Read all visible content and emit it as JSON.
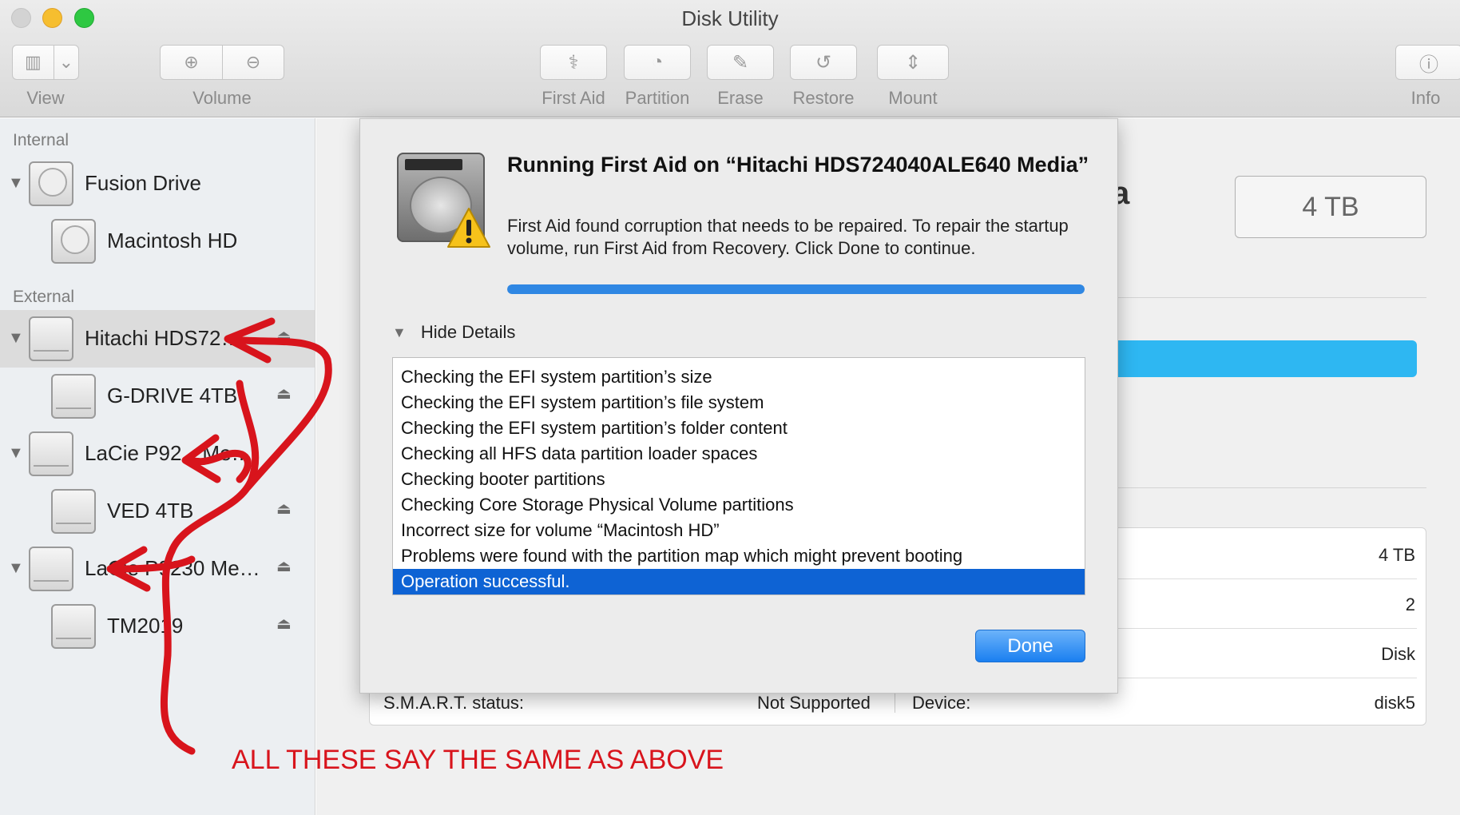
{
  "window": {
    "title": "Disk Utility"
  },
  "toolbar": {
    "view_label": "View",
    "volume_label": "Volume",
    "first_aid_label": "First Aid",
    "partition_label": "Partition",
    "erase_label": "Erase",
    "restore_label": "Restore",
    "mount_label": "Mount",
    "info_label": "Info"
  },
  "sidebar": {
    "internal_header": "Internal",
    "external_header": "External",
    "fusion_drive": "Fusion Drive",
    "macintosh_hd": "Macintosh HD",
    "hitachi": "Hitachi HDS72…",
    "g_drive": "G-DRIVE 4TB",
    "lacie_1": "LaCie P92…Me…",
    "ved": "VED 4TB",
    "lacie_2": "LaCie P9230 Me…",
    "tm2019": "TM2019"
  },
  "main": {
    "title_fragment": "a",
    "capacity": "4 TB",
    "rows": [
      {
        "value": "4 TB"
      },
      {
        "value": "2"
      },
      {
        "value": "Disk"
      }
    ],
    "smart_label": "S.M.A.R.T. status:",
    "smart_value": "Not Supported",
    "device_label": "Device:",
    "device_value": "disk5"
  },
  "sheet": {
    "title": "Running First Aid on “Hitachi HDS724040ALE640 Media”",
    "message": "First Aid found corruption that needs to be repaired. To repair the startup volume, run First Aid from Recovery. Click Done to continue.",
    "progress": 1.0,
    "details_toggle": "Hide Details",
    "log": [
      "Checking the EFI system partition’s size",
      "Checking the EFI system partition’s file system",
      "Checking the EFI system partition’s folder content",
      "Checking all HFS data partition loader spaces",
      "Checking booter partitions",
      "Checking Core Storage Physical Volume partitions",
      "Incorrect size for volume “Macintosh HD”",
      "Problems were found with the partition map which might prevent booting"
    ],
    "log_selected": "Operation successful.",
    "done_label": "Done"
  },
  "annotation": {
    "text": "ALL THESE SAY THE SAME AS ABOVE",
    "color": "#d8141c"
  }
}
